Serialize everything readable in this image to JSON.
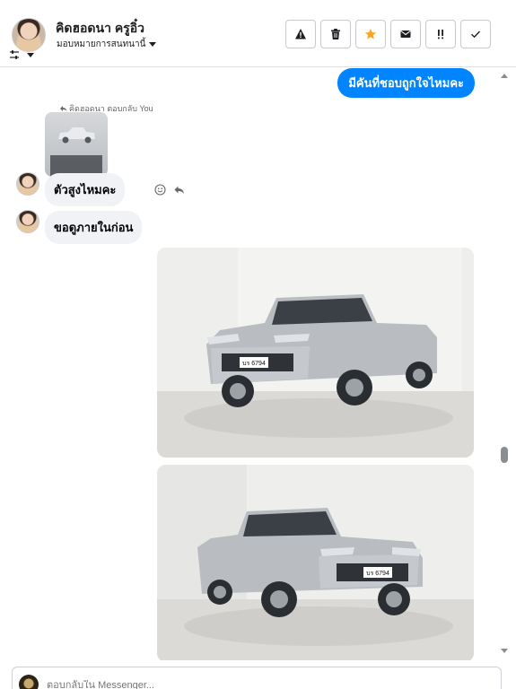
{
  "header": {
    "contact_name": "คิดฮอดนา ครูอิ๋ว",
    "assign_label": "มอบหมายการสนทนานี้",
    "actions": [
      {
        "name": "spam-button",
        "icon": "warning-icon"
      },
      {
        "name": "delete-button",
        "icon": "trash-icon"
      },
      {
        "name": "star-button",
        "icon": "star-icon"
      },
      {
        "name": "mark-unread-button",
        "icon": "envelope-icon"
      },
      {
        "name": "follow-up-button",
        "icon": "exclamation-icon"
      },
      {
        "name": "done-button",
        "icon": "check-icon"
      }
    ]
  },
  "thread": {
    "outgoing_top": "มีคันที่ชอบถูกใจไหมคะ",
    "reply_label": "คิดฮอดนา ตอบกลับ You",
    "messages": [
      {
        "text": "ตัวสูงไหมคะ"
      },
      {
        "text": "ขอดูภายในก่อน"
      }
    ],
    "plate_text": "บร 6794"
  },
  "composer": {
    "placeholder": "ตอบกลับใน Messenger..."
  },
  "colors": {
    "accent": "#0084ff",
    "star": "#f5a623",
    "bubble_in": "#f0f2f5"
  }
}
